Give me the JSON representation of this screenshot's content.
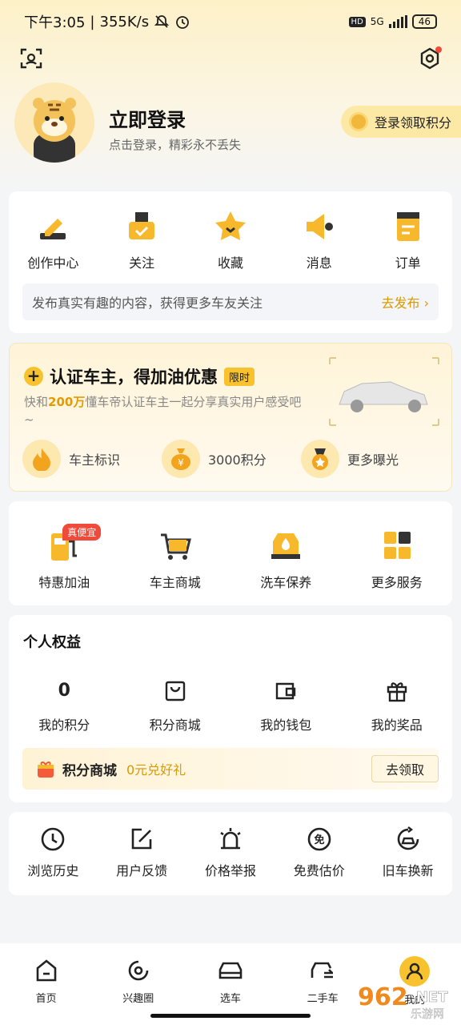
{
  "status": {
    "time": "下午3:05",
    "speed": "355K/s",
    "network": "5G",
    "battery": "46",
    "hd": "HD"
  },
  "profile": {
    "title": "立即登录",
    "subtitle": "点击登录，精彩永不丢失",
    "pill": "登录领取积分"
  },
  "quick": {
    "items": [
      {
        "label": "创作中心",
        "icon": "pen-icon"
      },
      {
        "label": "关注",
        "icon": "follow-icon"
      },
      {
        "label": "收藏",
        "icon": "star-icon"
      },
      {
        "label": "消息",
        "icon": "speaker-icon"
      },
      {
        "label": "订单",
        "icon": "order-icon"
      }
    ],
    "tip": "发布真实有趣的内容，获得更多车友关注",
    "tip_action": "去发布 ›"
  },
  "promo": {
    "title": "认证车主，得加油优惠",
    "tag": "限时",
    "desc_pre": "快和",
    "desc_num": "200万",
    "desc_post": "懂车帝认证车主一起分享真实用户感受吧 ~",
    "perks": [
      {
        "label": "车主标识",
        "icon": "flame-icon"
      },
      {
        "label": "3000积分",
        "icon": "money-bag-icon"
      },
      {
        "label": "更多曝光",
        "icon": "medal-icon"
      }
    ]
  },
  "services": {
    "items": [
      {
        "label": "特惠加油",
        "icon": "fuel-icon",
        "tag": "真便宜"
      },
      {
        "label": "车主商城",
        "icon": "cart-icon"
      },
      {
        "label": "洗车保养",
        "icon": "car-wash-icon"
      },
      {
        "label": "更多服务",
        "icon": "grid-icon"
      }
    ]
  },
  "rights": {
    "title": "个人权益",
    "items": [
      {
        "value": "0",
        "label": "我的积分"
      },
      {
        "label": "积分商城",
        "icon": "shopping-bag-icon"
      },
      {
        "label": "我的钱包",
        "icon": "wallet-icon"
      },
      {
        "label": "我的奖品",
        "icon": "gift-icon"
      }
    ],
    "mall_title": "积分商城",
    "mall_sub": "0元兑好礼",
    "mall_button": "去领取"
  },
  "tools": {
    "items": [
      {
        "label": "浏览历史",
        "icon": "clock-icon"
      },
      {
        "label": "用户反馈",
        "icon": "feedback-icon"
      },
      {
        "label": "价格举报",
        "icon": "alarm-icon"
      },
      {
        "label": "免费估价",
        "icon": "free-icon"
      },
      {
        "label": "旧车换新",
        "icon": "exchange-icon"
      }
    ]
  },
  "tabs": [
    {
      "label": "首页",
      "icon": "home-icon"
    },
    {
      "label": "兴趣圈",
      "icon": "circle-icon"
    },
    {
      "label": "选车",
      "icon": "car-icon"
    },
    {
      "label": "二手车",
      "icon": "used-car-icon"
    },
    {
      "label": "我的",
      "icon": "user-icon"
    }
  ],
  "watermark": "962.NET 乐游网"
}
